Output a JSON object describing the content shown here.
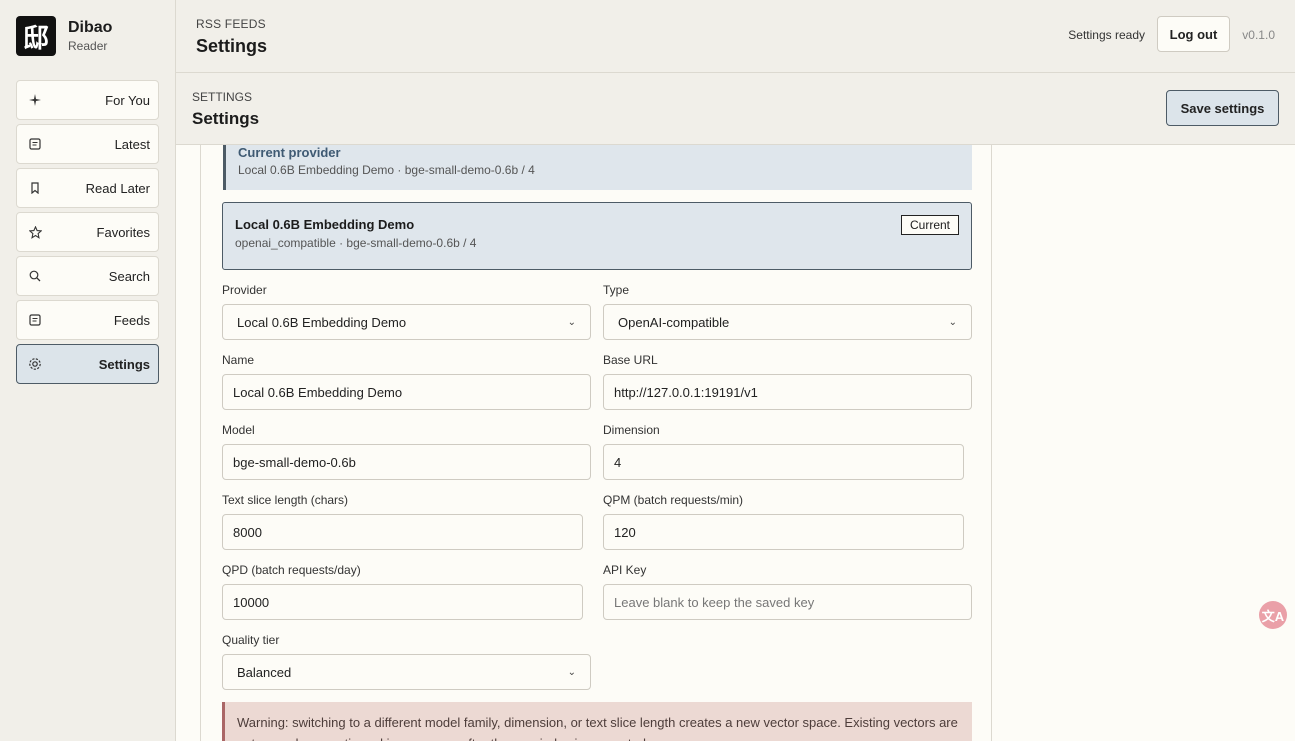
{
  "brand": {
    "title": "Dibao",
    "subtitle": "Reader",
    "logo_glyph": "邸"
  },
  "nav": [
    {
      "label": "For You",
      "icon": "sparkle-icon"
    },
    {
      "label": "Latest",
      "icon": "document-icon"
    },
    {
      "label": "Read Later",
      "icon": "bookmark-icon"
    },
    {
      "label": "Favorites",
      "icon": "star-icon"
    },
    {
      "label": "Search",
      "icon": "search-icon"
    },
    {
      "label": "Feeds",
      "icon": "feed-icon"
    },
    {
      "label": "Settings",
      "icon": "gear-icon",
      "active": true
    }
  ],
  "header": {
    "crumb": "RSS FEEDS",
    "title": "Settings",
    "status": "Settings ready",
    "logout_label": "Log out",
    "version": "v0.1.0"
  },
  "section": {
    "crumb": "SETTINGS",
    "title": "Settings",
    "save_label": "Save settings"
  },
  "current_provider": {
    "title": "Current provider",
    "summary": "Local 0.6B Embedding Demo · bge-small-demo-0.6b / 4"
  },
  "provider_card": {
    "name": "Local 0.6B Embedding Demo",
    "meta": "openai_compatible · bge-small-demo-0.6b / 4",
    "badge": "Current"
  },
  "form": {
    "provider": {
      "label": "Provider",
      "value": "Local 0.6B Embedding Demo"
    },
    "type": {
      "label": "Type",
      "value": "OpenAI-compatible"
    },
    "name": {
      "label": "Name",
      "value": "Local 0.6B Embedding Demo"
    },
    "base_url": {
      "label": "Base URL",
      "value": "http://127.0.0.1:19191/v1"
    },
    "model": {
      "label": "Model",
      "value": "bge-small-demo-0.6b"
    },
    "dimension": {
      "label": "Dimension",
      "value": "4"
    },
    "text_slice": {
      "label": "Text slice length (chars)",
      "value": "8000"
    },
    "qpm": {
      "label": "QPM (batch requests/min)",
      "value": "120"
    },
    "qpd": {
      "label": "QPD (batch requests/day)",
      "value": "10000"
    },
    "api_key": {
      "label": "API Key",
      "placeholder": "Leave blank to keep the saved key"
    },
    "quality": {
      "label": "Quality tier",
      "value": "Balanced"
    }
  },
  "warning": "Warning: switching to a different model family, dimension, or text slice length creates a new vector space. Existing vectors are not reused; semantic ranking resumes after the new index is generated.",
  "colors": {
    "accent_bg": "#dce4ea",
    "accent_border": "#4d5b66",
    "sidebar_bg": "#f1efe9",
    "warning_bg": "#ecd9d3",
    "fab": "#eaa0a8"
  }
}
